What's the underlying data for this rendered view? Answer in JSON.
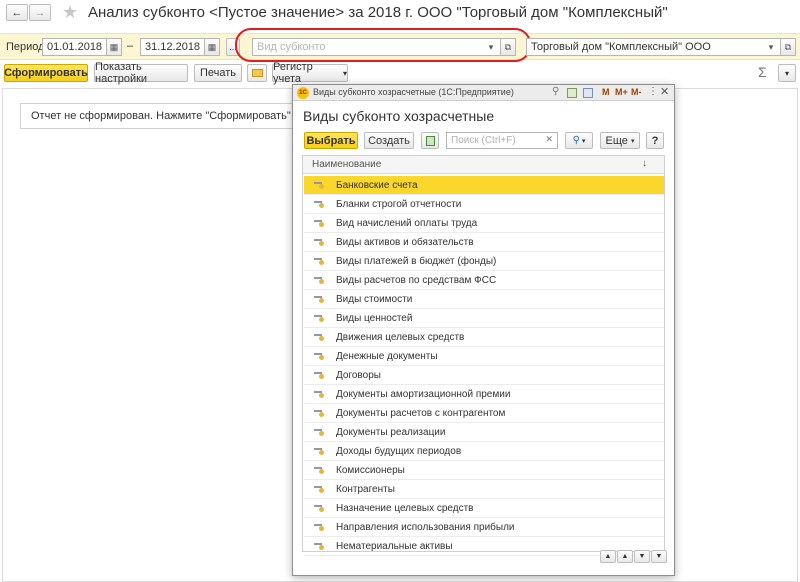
{
  "window": {
    "title": "Анализ субконто <Пустое значение> за 2018 г. ООО \"Торговый дом \"Комплексный\""
  },
  "filter": {
    "period_label": "Период:",
    "date_from": "01.01.2018",
    "dash": "–",
    "date_to": "31.12.2018",
    "dots": "...",
    "subconto_placeholder": "Вид субконто",
    "organization": "Торговый дом \"Комплексный\" ООО"
  },
  "toolbar": {
    "generate": "Сформировать",
    "show_settings": "Показать настройки",
    "print": "Печать",
    "register": "Регистр учета",
    "sigma": "Σ"
  },
  "report": {
    "message": "Отчет не сформирован. Нажмите \"Сформировать\" для получения"
  },
  "dialog": {
    "caption": "Виды субконто хозрасчетные (1С:Предприятие)",
    "title_buttons": [
      "M",
      "M+",
      "M-"
    ],
    "heading": "Виды субконто хозрасчетные",
    "select": "Выбрать",
    "create": "Создать",
    "search_placeholder": "Поиск (Ctrl+F)",
    "more": "Еще",
    "help": "?",
    "column_header": "Наименование",
    "sort_arrow": "↓",
    "items": [
      "Банковские счета",
      "Бланки строгой отчетности",
      "Вид начислений оплаты труда",
      "Виды активов и обязательств",
      "Виды платежей в бюджет (фонды)",
      "Виды расчетов по средствам ФСС",
      "Виды стоимости",
      "Виды ценностей",
      "Движения целевых средств",
      "Денежные документы",
      "Договоры",
      "Документы амортизационной премии",
      "Документы расчетов с контрагентом",
      "Документы реализации",
      "Доходы будущих периодов",
      "Комиссионеры",
      "Контрагенты",
      "Назначение целевых средств",
      "Направления использования прибыли",
      "Нематериальные активы"
    ]
  },
  "colors": {
    "selected_row": "#fbd72b",
    "filter_bar": "#fdf6d3",
    "highlight_oval": "#e31c1c"
  }
}
